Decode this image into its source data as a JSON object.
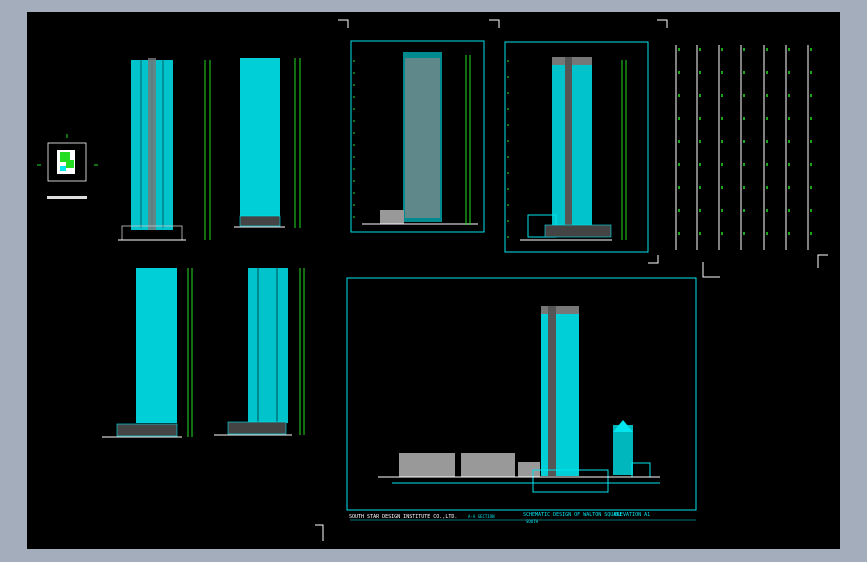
{
  "canvas": {
    "background": "#000000",
    "frame": "#a3adbb",
    "cyan": "#00e5ee",
    "green": "#22dd22",
    "white": "#ffffff",
    "gray": "#8a8a8a"
  },
  "title_block": {
    "left_text": "SOUTH STAR DESIGN INSTITUTE CO.,LTD.",
    "scale_text": "A-A SECTION",
    "center_text": "SCHEMATIC DESIGN OF WALTON SQUARE",
    "center_sub": "SOUTH",
    "right_text": "ELEVATION A1"
  },
  "icons": [
    "crosshair-corner-icon"
  ]
}
